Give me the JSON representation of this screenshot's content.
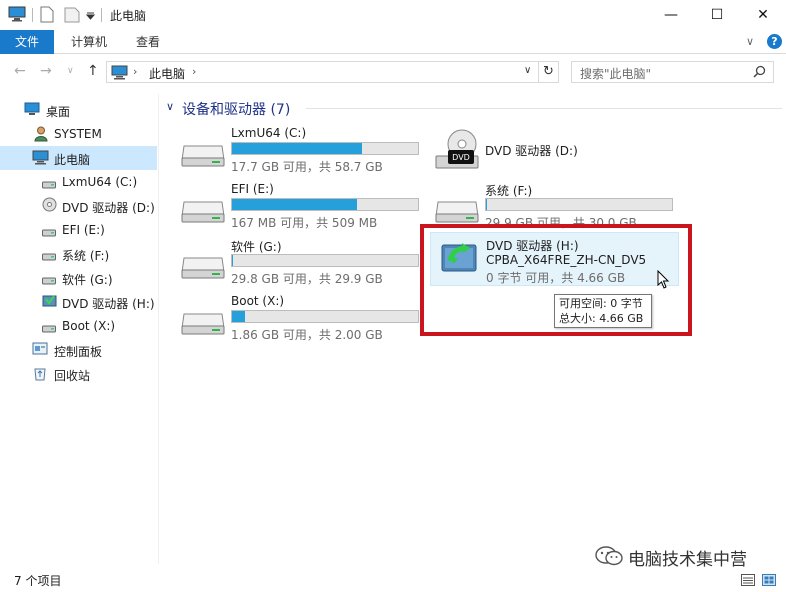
{
  "window": {
    "title": "此电脑",
    "minimize_glyph": "—",
    "maximize_glyph": "☐",
    "close_glyph": "✕"
  },
  "ribbon": {
    "tabs": [
      "文件",
      "计算机",
      "查看"
    ],
    "expand_glyph": "∨",
    "help_glyph": "?"
  },
  "address": {
    "path": "此电脑",
    "search_placeholder": "搜索\"此电脑\""
  },
  "sidebar": {
    "items": [
      {
        "label": "桌面",
        "icon": "desktop-icon"
      },
      {
        "label": "SYSTEM",
        "icon": "user-icon"
      },
      {
        "label": "此电脑",
        "icon": "computer-icon",
        "selected": true
      },
      {
        "label": "LxmU64 (C:)",
        "icon": "drive-icon"
      },
      {
        "label": "DVD 驱动器 (D:)",
        "icon": "dvd-icon"
      },
      {
        "label": "EFI (E:)",
        "icon": "drive-icon"
      },
      {
        "label": "系统 (F:)",
        "icon": "drive-icon"
      },
      {
        "label": "软件 (G:)",
        "icon": "drive-icon"
      },
      {
        "label": "DVD 驱动器 (H:)",
        "icon": "dvd-setup-icon"
      },
      {
        "label": "Boot (X:)",
        "icon": "drive-icon"
      },
      {
        "label": "控制面板",
        "icon": "control-panel-icon"
      },
      {
        "label": "回收站",
        "icon": "recycle-bin-icon"
      }
    ]
  },
  "content": {
    "group_header": "设备和驱动器 (7)",
    "drives": [
      {
        "name": "LxmU64 (C:)",
        "info": "17.7 GB 可用，共 58.7 GB",
        "used_fraction": 0.7
      },
      {
        "name": "DVD 驱动器 (D:)",
        "info": ""
      },
      {
        "name": "EFI (E:)",
        "info": "167 MB 可用，共 509 MB",
        "used_fraction": 0.67
      },
      {
        "name": "系统 (F:)",
        "info": "29.9 GB 可用，共 30.0 GB",
        "used_fraction": 0.003
      },
      {
        "name": "软件 (G:)",
        "info": "29.8 GB 可用，共 29.9 GB",
        "used_fraction": 0.003
      },
      {
        "name": "DVD 驱动器 (H:)",
        "label": "CPBA_X64FRE_ZH-CN_DV5",
        "info": "0 字节 可用，共 4.66 GB"
      },
      {
        "name": "Boot (X:)",
        "info": "1.86 GB 可用，共 2.00 GB",
        "used_fraction": 0.07
      }
    ]
  },
  "tooltip": {
    "line1": "可用空间: 0 字节",
    "line2": "总大小: 4.66 GB"
  },
  "status": {
    "count": "7 个项目"
  },
  "watermark": {
    "text": "电脑技术集中营"
  },
  "colors": {
    "accent": "#1979ca",
    "bar_fill": "#26a0da",
    "highlight": "#c9161e",
    "selected_bg": "#cce8ff"
  }
}
